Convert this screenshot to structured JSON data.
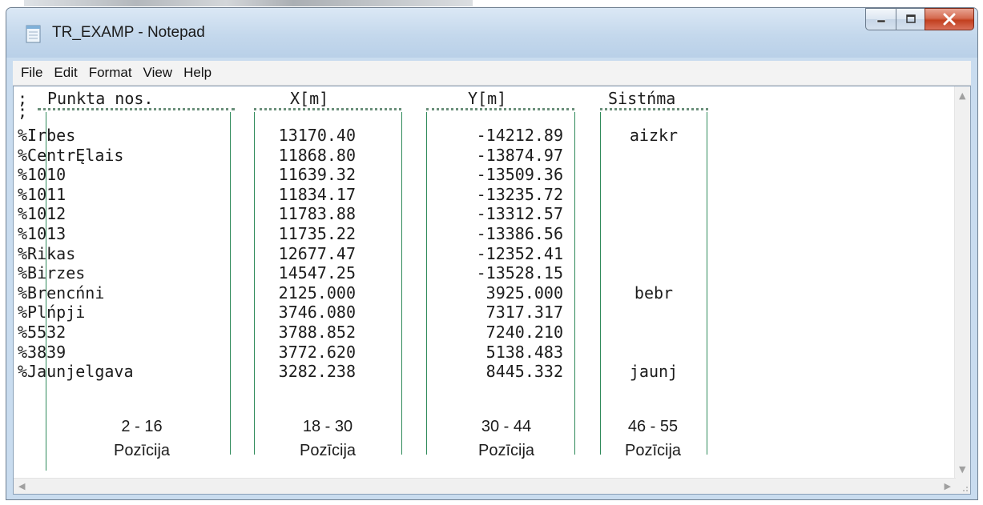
{
  "window": {
    "title": "TR_EXAMP - Notepad"
  },
  "menu": [
    "File",
    "Edit",
    "Format",
    "View",
    "Help"
  ],
  "header": {
    "semicolon": ";",
    "name": "Punkta nos.",
    "x": "X[m]",
    "y": "Y[m]",
    "system": "Sistńma",
    "second_line": ";"
  },
  "rows": [
    {
      "name": "%Irbes",
      "x": "13170.40",
      "y": "-14212.89",
      "sys": "aizkr"
    },
    {
      "name": "%CentrĘlais",
      "x": "11868.80",
      "y": "-13874.97",
      "sys": ""
    },
    {
      "name": "%1010",
      "x": "11639.32",
      "y": "-13509.36",
      "sys": ""
    },
    {
      "name": "%1011",
      "x": "11834.17",
      "y": "-13235.72",
      "sys": ""
    },
    {
      "name": "%1012",
      "x": "11783.88",
      "y": "-13312.57",
      "sys": ""
    },
    {
      "name": "%1013",
      "x": "11735.22",
      "y": "-13386.56",
      "sys": ""
    },
    {
      "name": "%Rikas",
      "x": "12677.47",
      "y": "-12352.41",
      "sys": ""
    },
    {
      "name": "%Birzes",
      "x": "14547.25",
      "y": "-13528.15",
      "sys": ""
    },
    {
      "name": "%Brencńni",
      "x": "2125.000",
      "y": "3925.000",
      "sys": "bebr"
    },
    {
      "name": "%Plńpji",
      "x": "3746.080",
      "y": "7317.317",
      "sys": ""
    },
    {
      "name": "%5532",
      "x": "3788.852",
      "y": "7240.210",
      "sys": ""
    },
    {
      "name": "%3839",
      "x": "3772.620",
      "y": "5138.483",
      "sys": ""
    },
    {
      "name": "%Jaunjelgava",
      "x": "3282.238",
      "y": "8445.332",
      "sys": "jaunj"
    }
  ],
  "footer": [
    {
      "range": "2 - 16",
      "label": "Pozīcija"
    },
    {
      "range": "18 - 30",
      "label": "Pozīcija"
    },
    {
      "range": "30 - 44",
      "label": "Pozīcija"
    },
    {
      "range": "46 - 55",
      "label": "Pozīcija"
    }
  ],
  "icons": {
    "app": "notepad-icon",
    "minimize": "minimize-icon",
    "maximize": "maximize-icon",
    "close": "close-icon"
  },
  "colors": {
    "column_lines": "#2f8a5a",
    "close_button": "#c2401f"
  }
}
